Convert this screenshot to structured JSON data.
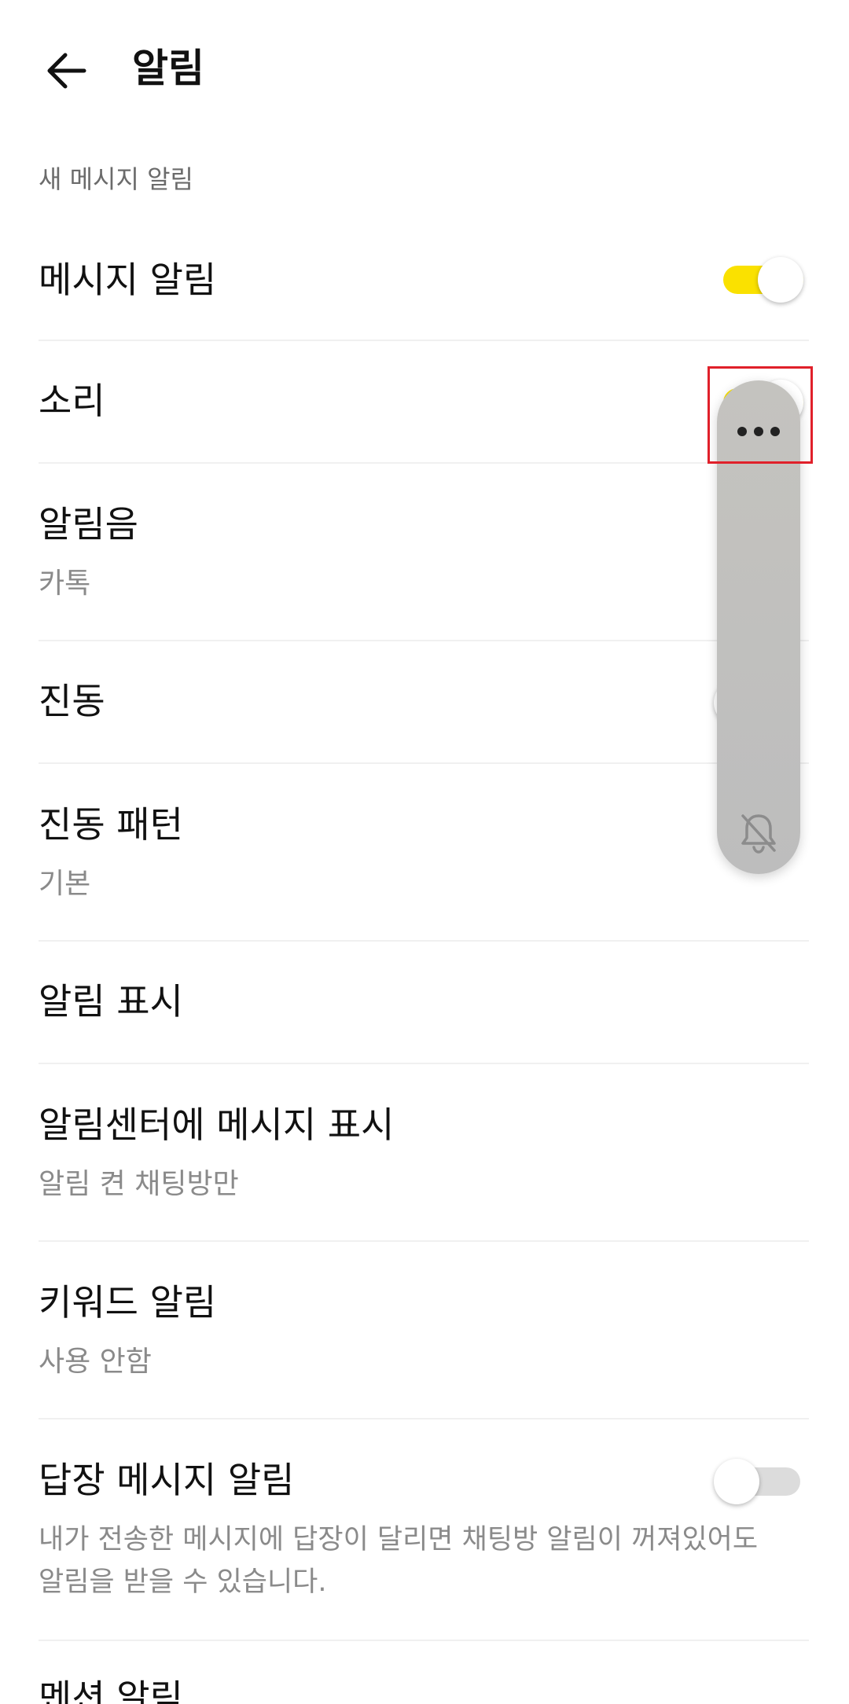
{
  "header": {
    "title": "알림",
    "back_icon": "arrow-left-icon"
  },
  "section": {
    "title": "새 메시지 알림"
  },
  "rows": {
    "message_alert": {
      "title": "메시지 알림",
      "toggle": "on"
    },
    "sound": {
      "title": "소리",
      "toggle": "on"
    },
    "ringtone": {
      "title": "알림음",
      "value": "카톡"
    },
    "vibration": {
      "title": "진동",
      "toggle": "off"
    },
    "vibration_pattern": {
      "title": "진동 패턴",
      "value": "기본"
    },
    "notification_display": {
      "title": "알림 표시"
    },
    "notification_center": {
      "title": "알림센터에 메시지 표시",
      "value": "알림 켠 채팅방만"
    },
    "keyword_alert": {
      "title": "키워드 알림",
      "value": "사용 안함"
    },
    "reply_alert": {
      "title": "답장 메시지 알림",
      "description_line1": "내가 전송한 메시지에 답장이 달리면 채팅방 알림이 꺼져있어도",
      "description_line2": "알림을 받을 수 있습니다.",
      "toggle": "off"
    },
    "mention_alert": {
      "title": "멘션 알림"
    }
  },
  "floating_panel": {
    "more_icon": "more-horizontal-icon",
    "bell_icon": "bell-off-icon"
  },
  "colors": {
    "accent": "#fae100",
    "highlight": "#e0202a",
    "toggle_off": "#dcdcdc",
    "secondary_text": "#8a8a8a"
  }
}
